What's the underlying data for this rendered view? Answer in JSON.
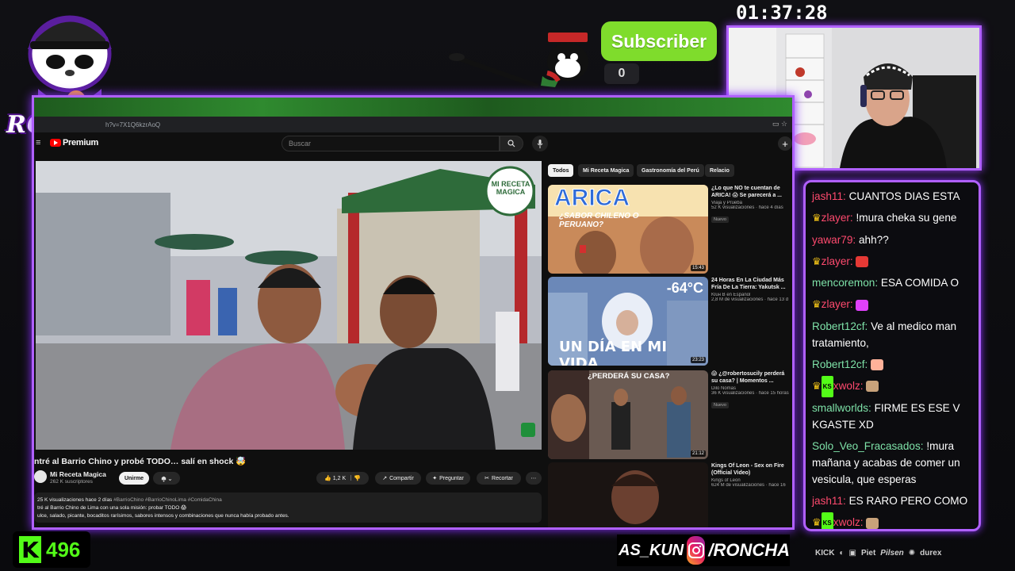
{
  "overlay": {
    "logo_text": "RONCHAS",
    "subscribe_label": "Subscriber",
    "subscriber_count": "0",
    "clock": "01:37:28",
    "kick_viewers": "496",
    "social_handle_1": "AS_KUN",
    "social_handle_2": "/RONCHA",
    "sponsors": [
      "KICK",
      "Discord",
      "Twitch",
      "Piet",
      "Pilsen",
      "Plus",
      "durex"
    ],
    "accent_color": "#b060ff",
    "kick_color": "#53fc18",
    "subscribe_color": "#7fdc2c"
  },
  "browser": {
    "url": "h?v=7X1Q6kzrAoQ",
    "youtube_brand": "Premium",
    "search_placeholder": "Buscar"
  },
  "video": {
    "title": "ntré al Barrio Chino y probé TODO… salí en shock 🤯",
    "channel": "Mi Receta Magica",
    "subscribers": "262 K suscriptores",
    "join_label": "Unirme",
    "likes": "1,2 K",
    "share_label": "Compartir",
    "ask_label": "Preguntar",
    "clip_label": "Recortar",
    "watermark": "MI RECETA MAGICA",
    "description": {
      "stats": "25 K visualizaciones  hace 2 días",
      "tags": "#BarrioChino #BarrioChinoLima #ComidaChina",
      "line1": "tré al Barrio Chino de Lima con una sola misión: probar TODO 😱",
      "line2": "ulce, salado, picante, bocaditos rarísimos, sabores intensos y combinaciones que nunca había probado antes."
    }
  },
  "chips": [
    "Todos",
    "Mi Receta Magica",
    "Gastronomía del Perú",
    "Relacio"
  ],
  "recommendations": [
    {
      "title": "¿Lo que NO te cuentan de ARICA! 😱 Se parecerá a ...",
      "channel": "Viaja y Prueba",
      "meta": "52 K visualizaciones · hace 4 días",
      "badge": "Nuevo",
      "duration": "15:43",
      "thumb_text_1": "ARICA",
      "thumb_text_2": "¿SABOR CHILENO O PERUANO?"
    },
    {
      "title": "24 Horas En La Ciudad Más Fría De La Tierra: Yakutsk ...",
      "channel": "Kluн B en Español",
      "meta": "2,8 M de visualizaciones · hace 13 d",
      "badge": "",
      "duration": "23:23",
      "thumb_text_1": "-64°C",
      "thumb_text_2": "UN DÍA EN MI VIDA"
    },
    {
      "title": "😱 ¿@robertosucily perderá su casa? | Momentos ...",
      "channel": "Dilo Nomas",
      "meta": "36 K visualizaciones · hace 15 horas",
      "badge": "Nuevo",
      "duration": "21:12",
      "thumb_text_1": "¿PERDERÁ SU CASA?",
      "thumb_text_2": ""
    },
    {
      "title": "Kings Of Leon - Sex on Fire (Official Video)",
      "channel": "Kings of Leon",
      "meta": "624 M de visualizaciones · hace 16",
      "badge": "",
      "duration": "",
      "thumb_text_1": "",
      "thumb_text_2": ""
    }
  ],
  "chat": [
    {
      "user": "jash11:",
      "color": "#ff4a6e",
      "crown": false,
      "kick": false,
      "text": "CUANTOS DIAS ESTA"
    },
    {
      "user": "zlayer:",
      "color": "#ff4a6e",
      "crown": true,
      "kick": false,
      "text": "!mura cheka su gene"
    },
    {
      "user": "yawar79:",
      "color": "#ff4a6e",
      "crown": false,
      "kick": false,
      "text": "ahh??"
    },
    {
      "user": "zlayer:",
      "color": "#ff4a6e",
      "crown": true,
      "kick": false,
      "text": "",
      "emoji": "#e53935"
    },
    {
      "user": "mencoremon:",
      "color": "#7ee2a8",
      "crown": false,
      "kick": false,
      "text": "ESA COMIDA O"
    },
    {
      "user": "zlayer:",
      "color": "#ff4a6e",
      "crown": true,
      "kick": false,
      "text": "",
      "emoji": "#e040fb"
    },
    {
      "user": "Robert12cf:",
      "color": "#7ee2a8",
      "crown": false,
      "kick": false,
      "text": "Ve al medico man tratamiento,",
      "wrap": true
    },
    {
      "user": "Robert12cf:",
      "color": "#7ee2a8",
      "crown": false,
      "kick": false,
      "text": "",
      "emoji": "#ffb199"
    },
    {
      "user": "xwolz:",
      "color": "#ff4a6e",
      "crown": true,
      "kick": true,
      "text": "",
      "emoji": "#c8a27a"
    },
    {
      "user": "smallworlds:",
      "color": "#7ee2a8",
      "crown": false,
      "kick": false,
      "text": "FIRME ES ESE V KGASTE XD",
      "wrap": true
    },
    {
      "user": "Solo_Veo_Fracasados:",
      "color": "#7ee2a8",
      "crown": false,
      "kick": false,
      "text": "!mura mañana y acabas de comer un vesicula, que esperas",
      "wrap": true
    },
    {
      "user": "jash11:",
      "color": "#ff4a6e",
      "crown": false,
      "kick": false,
      "text": "ES RARO PERO COMO"
    },
    {
      "user": "xwolz:",
      "color": "#ff4a6e",
      "crown": true,
      "kick": true,
      "text": "",
      "emoji": "#c8a27a"
    }
  ]
}
